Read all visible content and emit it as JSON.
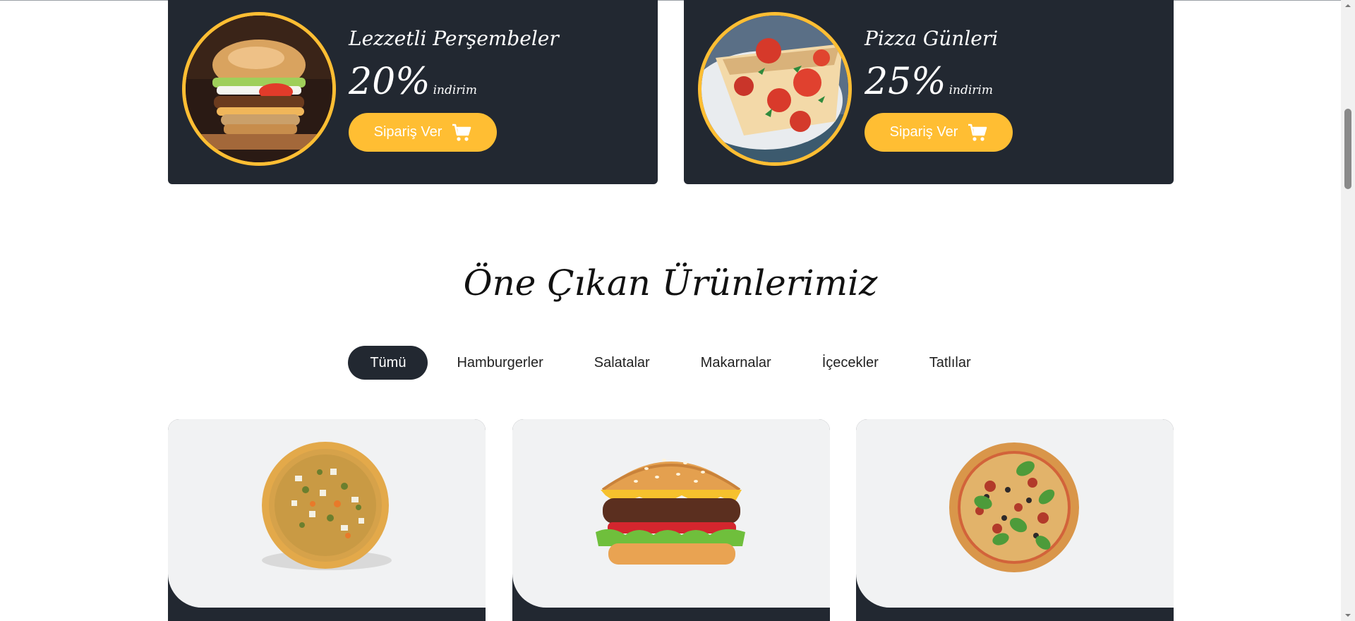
{
  "offers": [
    {
      "title": "Lezzetli Perşembeler",
      "percent": "20%",
      "label": "indirim",
      "button": "Sipariş Ver",
      "image_icon": "burger-photo",
      "cart_icon": "cart-icon"
    },
    {
      "title": "Pizza Günleri",
      "percent": "25%",
      "label": "indirim",
      "button": "Sipariş Ver",
      "image_icon": "pizza-photo",
      "cart_icon": "cart-icon"
    }
  ],
  "section": {
    "title": "Öne Çıkan Ürünlerimiz"
  },
  "filters": [
    {
      "label": "Tümü",
      "active": true
    },
    {
      "label": "Hamburgerler",
      "active": false
    },
    {
      "label": "Salatalar",
      "active": false
    },
    {
      "label": "Makarnalar",
      "active": false
    },
    {
      "label": "İçecekler",
      "active": false
    },
    {
      "label": "Tatlılar",
      "active": false
    }
  ],
  "products": [
    {
      "image_icon": "pizza-image"
    },
    {
      "image_icon": "burger-image"
    },
    {
      "image_icon": "pizza-image"
    }
  ],
  "colors": {
    "dark": "#222831",
    "accent": "#ffbe33",
    "card_bg": "#f1f2f3"
  }
}
